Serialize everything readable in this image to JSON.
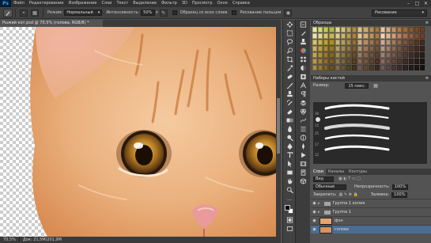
{
  "app": {
    "logo": "Ps"
  },
  "menu": [
    "Файл",
    "Редактирование",
    "Изображение",
    "Слои",
    "Текст",
    "Выделение",
    "Фильтр",
    "3D",
    "Просмотр",
    "Окно",
    "Справка"
  ],
  "window_controls": {
    "minimize": "–",
    "maximize": "□",
    "close": "✕"
  },
  "options": {
    "mode_label": "Режим:",
    "mode_value": "Нормальный",
    "intensity_label": "Интенсивность:",
    "intensity_value": "50%",
    "sample_all_label": "Образец со всех слоев",
    "finger_paint_label": "Рисование пальцем",
    "workspace_value": "Рисование"
  },
  "document": {
    "tab_title": "Рыжий кот.psd @ 70,5% (голова, RGB/8) *",
    "status_zoom": "70,5%",
    "status_doc": "Док: 21,5М/201,9М"
  },
  "panels": {
    "swatches_title": "Образцы",
    "brushes_title": "Наборы кистей",
    "size_label": "Размер:",
    "size_value": "15 пикс.",
    "brush_numbers": [
      "30",
      "15",
      "25",
      "17",
      "12"
    ],
    "swatch_colors": [
      "#e7e8a2",
      "#d8d97a",
      "#c6c85a",
      "#b6b744",
      "#e0d79a",
      "#cfc37a",
      "#bca85c",
      "#a98f45",
      "#d9c38f",
      "#c8ab6f",
      "#b69253",
      "#a17a3c",
      "#e4c7a5",
      "#d3ad84",
      "#c29365",
      "#ae7b4c",
      "#9c6a3b",
      "#8a5a30",
      "#7a4d28",
      "#6a4122",
      "#f0e6b0",
      "#e6d88e",
      "#d9c66c",
      "#ccb450",
      "#dccb8a",
      "#c9b46b",
      "#b79c52",
      "#a4853e",
      "#e2c79a",
      "#d1ae7a",
      "#be945f",
      "#aa7b49",
      "#f0d2b8",
      "#e3b998",
      "#d29f7a",
      "#c0865f",
      "#ac704b",
      "#965d3c",
      "#824d30",
      "#6e3f27",
      "#d6c46a",
      "#c8b24f",
      "#bb9f3c",
      "#ad8d2f",
      "#c9b57a",
      "#b69e5e",
      "#a48848",
      "#8f7236",
      "#c5a880",
      "#b18e66",
      "#9e7651",
      "#8a603e",
      "#c9ac95",
      "#b69479",
      "#a27c60",
      "#8e674b",
      "#7a543b",
      "#67442f",
      "#553725",
      "#452c1e",
      "#cdb35f",
      "#bb9e45",
      "#a98a33",
      "#977727",
      "#b6a067",
      "#a38a50",
      "#90753d",
      "#7c602e",
      "#ae9270",
      "#9a7958",
      "#876345",
      "#744f36",
      "#b59583",
      "#a07d69",
      "#8b6754",
      "#775342",
      "#634334",
      "#523629",
      "#432b20",
      "#352219",
      "#c2a455",
      "#ae8d3e",
      "#9a772d",
      "#866322",
      "#a38c5a",
      "#8f7545",
      "#7b6034",
      "#684d27",
      "#9a7c62",
      "#86654c",
      "#73513a",
      "#60402c",
      "#9e7f70",
      "#8a6a5b",
      "#765749",
      "#63473a",
      "#51392e",
      "#422e24",
      "#35251d",
      "#2a1d17",
      "#b69a50",
      "#a2843a",
      "#8e6f2a",
      "#7a5b20",
      "#8f7a50",
      "#7b653d",
      "#67522e",
      "#554022",
      "#866a54",
      "#725540",
      "#5f4330",
      "#4d3424",
      "#876a60",
      "#73574d",
      "#60463d",
      "#4e3830",
      "#3e2c25",
      "#32231d",
      "#281c17",
      "#201612",
      "#a78d48",
      "#937835",
      "#7f6427",
      "#6c511e",
      "#7c6a48",
      "#685637",
      "#554428",
      "#44341d",
      "#735b4a",
      "#604837",
      "#4e382a",
      "#3e2b1f",
      "#705853",
      "#5d4743",
      "#4b3834",
      "#3c2c29",
      "#2f2320",
      "#261c19",
      "#1f1714",
      "#191210"
    ]
  },
  "layers": {
    "tabs": [
      "Слои",
      "Каналы",
      "Контуры"
    ],
    "kind_label": "Вид",
    "blend_value": "Обычные",
    "opacity_label": "Непрозрачность:",
    "opacity_value": "100%",
    "lock_label": "Закрепить:",
    "fill_label": "Заливка:",
    "fill_value": "100%",
    "rows": [
      {
        "name": "Группа 1 копия",
        "type": "group"
      },
      {
        "name": "Группа 1",
        "type": "group"
      },
      {
        "name": "фон",
        "type": "layer",
        "thumb": "#e5a470"
      },
      {
        "name": "голова",
        "type": "layer",
        "thumb": "#d9935c",
        "selected": true
      }
    ]
  }
}
